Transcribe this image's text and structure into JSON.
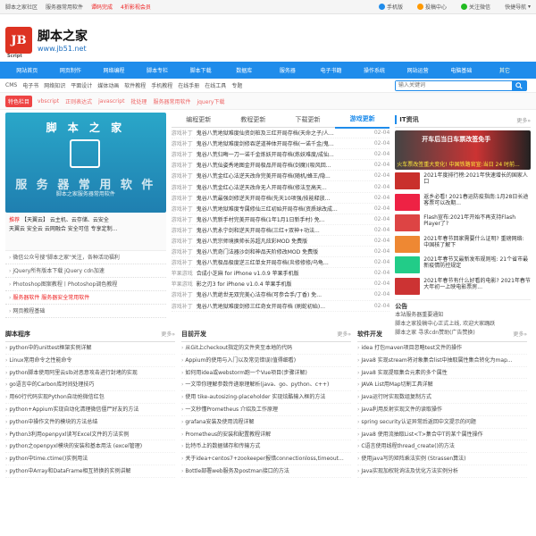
{
  "topbar": {
    "links": [
      "脚本之家社区",
      "服务器常用软件",
      "谭码完成",
      "4折影视会员"
    ],
    "right": [
      "手机版",
      "投稿中心",
      "关注微信",
      "快捷导航"
    ]
  },
  "header": {
    "logo_text": "JB",
    "logo_sub": "Script",
    "site_name": "脚本之家",
    "site_url": "www.jb51.net"
  },
  "nav": {
    "items": [
      "网站首页",
      "网页制作",
      "网络编程",
      "脚本专栏",
      "脚本下载",
      "数据库",
      "服务器",
      "电子书籍",
      "操作系统",
      "网站运营",
      "电脑基础",
      "其它"
    ]
  },
  "subnav": {
    "links": [
      "CMS",
      "电子书",
      "网络知识",
      "平面设计",
      "媒体动画",
      "软件教程",
      "手机教程",
      "在线手册",
      "在线工具",
      "专题"
    ],
    "search_placeholder": "输入关键词"
  },
  "special": {
    "badge": "特色栏目",
    "items": [
      "vbscript",
      "正则表达式",
      "javascript",
      "批处理",
      "服务器常用软件",
      "jquery下载"
    ]
  },
  "banner": {
    "title": "脚 本 之 家",
    "subtitle": "服 务 器 常 用 软 件",
    "caption": "脚本之家服务器常用软件"
  },
  "recommend": {
    "label": "推荐",
    "line1": "【天翼云】 云主机、云存储、云安全",
    "line2": "天翼云 安全云 云网融合 安全可信 专享定制..."
  },
  "left_list": [
    "微信公众号搜\"脚本之家\"关注，各种活动福利",
    "jQuery所有版本下载 jQuery cdn加速",
    "Photoshop图案教程丨Photoshop调色教程",
    "服务器软件 服务器安全常用软件",
    "网页教程基础"
  ],
  "tabs": [
    "编程更新",
    "教程更新",
    "下载更新",
    "游戏更新"
  ],
  "center_list": [
    {
      "cat": "游戏补丁",
      "title": "鬼谷八荒地狱难度仙资剑桩及三红开局存档(天命之子/人...",
      "date": "02-04"
    },
    {
      "cat": "游戏补丁",
      "title": "鬼谷八荒地狱难度剑修吞逆道神体开局存档(一诺千金/鬼...",
      "date": "02-04"
    },
    {
      "cat": "游戏补丁",
      "title": "鬼谷八荒归晦一刀一诺千金炼妖开局存档(炼妖难度/成仙...",
      "date": "02-04"
    },
    {
      "cat": "游戏补丁",
      "title": "鬼谷八荒仙姿秀地图金开局极品开局存档(剑魔)(吸风回...",
      "date": "02-04"
    },
    {
      "cat": "游戏补丁",
      "title": "鬼谷八荒金红心法逆天改命完美开局存档(随机/蜂王/隐...",
      "date": "02-04"
    },
    {
      "cat": "游戏补丁",
      "title": "鬼谷八荒金红心法逆天改命无人开局存档(修法至高天...",
      "date": "02-04"
    },
    {
      "cat": "游戏补丁",
      "title": "鬼谷八荒最强剑修逆天开局存档(先天10项强/技能释放...",
      "date": "02-04"
    },
    {
      "cat": "游戏补丁",
      "title": "鬼谷八荒地狱难度专属修仙三红初始开局存档(资质球改成...",
      "date": "02-04"
    },
    {
      "cat": "游戏补丁",
      "title": "鬼谷八荒新手村完美开局存档(1年1月1日新手村) 免...",
      "date": "02-04"
    },
    {
      "cat": "游戏补丁",
      "title": "鬼谷八荒永宁剑和逆天开局存档(三红+双神+功法...",
      "date": "02-04"
    },
    {
      "cat": "游戏补丁",
      "title": "鬼谷八荒宗师境换帅长苏超凡炫彩MOD 免费版",
      "date": "02-04"
    },
    {
      "cat": "游戏补丁",
      "title": "鬼谷八荒奇门法器沙剑和神品天阶修改MOD 免费版",
      "date": "02-04"
    },
    {
      "cat": "游戏补丁",
      "title": "鬼谷八荒极品极度逆三红单女开局存档(炎修修修/乌龟...",
      "date": "02-04"
    },
    {
      "cat": "苹果游戏",
      "title": "合成小芝麻 for iPhone v1.0.9 苹果手机版",
      "date": "02-04"
    },
    {
      "cat": "苹果游戏",
      "title": "影之刃3 for iPhone v1.0.4 苹果手机版",
      "date": "02-04"
    },
    {
      "cat": "游戏补丁",
      "title": "鬼谷八荒绝世无双完美心法存档(可参合手/丁香) 免...",
      "date": "02-04"
    },
    {
      "cat": "游戏补丁",
      "title": "鬼谷八荒地狱难度剑修三红奇女开局存档 (刷蛇初始)...",
      "date": "02-04"
    }
  ],
  "it_news": {
    "head": "IT资讯",
    "more": "更多»",
    "hot_label": "开车后当日车票改签免手",
    "hot_caption": "火车票改签重大变化! 中国铁路官宣:当日 24 时前...",
    "items": [
      "2021年度排行榜:2021年快速增长的国家人口",
      "返乡必看! 2021春运防疫指南:1月28日长途客票可以改期...",
      "Flash宣布:2021年开始不再支持Flash Player了?",
      "2021年春节回家需要什么证明? 重磅网络: 中国核了解下",
      "2021年春节又最新发布规则啦: 21个省市最新疫情防控规定",
      "2021年春节有什么好看的电影? 2021年春节大年初一上映电影票房..."
    ]
  },
  "notice": {
    "head": "公告",
    "items": [
      "本站服务器重要通知",
      "脚本之家投稿中心正式上线, 欢迎大家踊跃",
      "脚本之家 寻求cdn赞助(广告赞换)"
    ]
  },
  "bottom": [
    {
      "head": "脚本程序",
      "more": "更多»",
      "items": [
        "python中的unittest框架实例详解",
        "Linux常用命令之性能命令",
        "python脚本使用阿里云slb对恶意攻击进行封堵的实现",
        "go语言中的Carbon库时间处理技巧",
        "用60行代码实现Python自动抢微信红包",
        "python+Appium实现自动化清理微信僵尸好友的方法",
        "python中操作文件的模块的方法总结",
        "Python3利用openpyxl读写Excel文件的方法实例",
        "python之openpyxl模块的安装和基本用法 (excel管理)",
        "python中time.ctime()实例用法",
        "python中Array和DataFrame相互转换的实例讲解"
      ]
    },
    {
      "head": "目前开发",
      "more": "更多»",
      "items": [
        "从Git上checkout指定的文件夹至本地的代码",
        "Appium的使用与入门以及常见错误(值得细看)",
        "如何用idea或webstorm跑一个Vue项目(步骤详解)",
        "一文带你理解参数传递原理解析(java、go、python、c++)",
        "使用 tike-autosizing-placeholder 实现炫酷输入框的方法",
        "一文秒懂Prometheus 介绍及工作原理",
        "grafana安装及使用流程详解",
        "Prometheus的安装和配置教程详解",
        "比特币上的数据储存和传输方式",
        "关于idea+centos7+zookeeper报错connectionloss,timeout...",
        "Bottle部署web服务及postman接口的方法"
      ]
    },
    {
      "head": "软件开发",
      "more": "更多»",
      "items": [
        "idea 打包maven项目忽略test文件的操作",
        "Java8 实现stream将对象集合list中抽取属性集合转化为map...",
        "Java8 实现提取集合元素的多个属性",
        "JAVA List用Map切割工具详解",
        "Java运行时实现数组复制方式",
        "Java利用反射实现文件的读取操作",
        "spring security认证异常后返回中文提示的问题",
        "Java8 使用流抽取List<T>集合中T的某个属性操作",
        "C语言使用线程thread_create()的方法",
        "使用java写的矩阵乘法实例 (Strassen算法)",
        "Java实现加权轮询法及优化方法实例分析"
      ]
    }
  ]
}
